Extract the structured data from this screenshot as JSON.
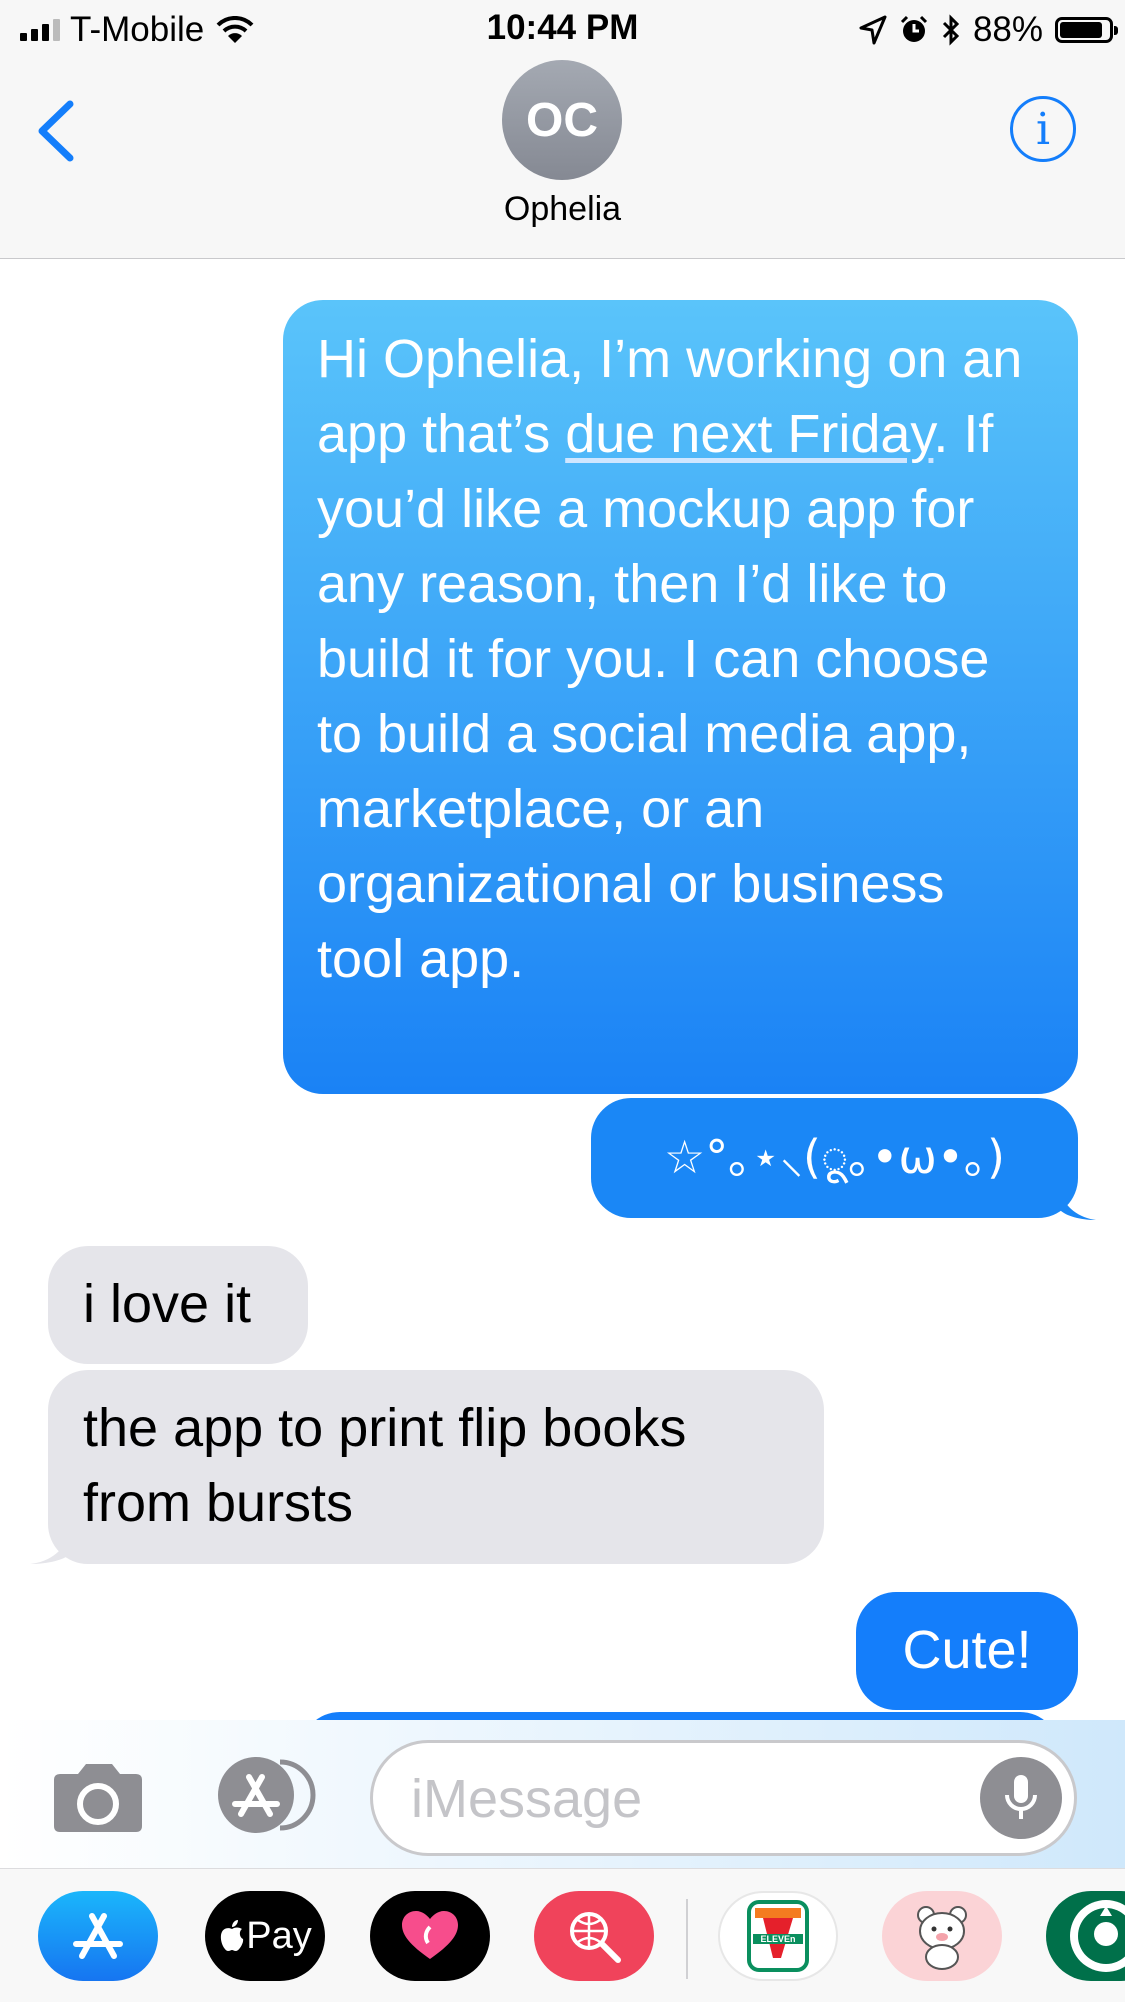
{
  "status_bar": {
    "carrier": "T-Mobile",
    "time": "10:44 PM",
    "battery": "88%",
    "battery_level": 0.88,
    "icons": [
      "signal-icon",
      "wifi-icon",
      "location-icon",
      "alarm-icon",
      "bluetooth-icon",
      "battery-icon"
    ]
  },
  "header": {
    "avatar_initials": "OC",
    "contact_name": "Ophelia",
    "icons": [
      "chevron-left-icon",
      "info-icon"
    ]
  },
  "messages": [
    {
      "direction": "outgoing",
      "part1": "Hi Ophelia, I’m working on an app that’s ",
      "link": "due next Friday",
      "part2": ". If you’d like a mockup app for any reason, then I’d like to build it for you. I can choose to build a social media app, marketplace, or an organizational or business tool app."
    },
    {
      "direction": "outgoing",
      "text": "☆°｡⋆⸜(ू｡•ω•｡)"
    },
    {
      "direction": "incoming",
      "text": "i love it"
    },
    {
      "direction": "incoming",
      "text": "the app to print flip books from bursts"
    },
    {
      "direction": "outgoing",
      "text": "Cute!"
    }
  ],
  "input_bar": {
    "placeholder": "iMessage",
    "icons": [
      "camera-icon",
      "app-store-icon",
      "microphone-icon"
    ]
  },
  "app_drawer": {
    "apps": [
      {
        "name": "App Store",
        "icon": "app-store-icon"
      },
      {
        "name": "Apple Pay",
        "label": "Pay",
        "icon": "apple-pay-icon"
      },
      {
        "name": "Digital Touch",
        "icon": "heart-icon"
      },
      {
        "name": "Search",
        "icon": "globe-search-icon"
      },
      {
        "name": "7-Eleven",
        "label": "ELEVEn",
        "icon": "seven-eleven-icon"
      },
      {
        "name": "Bear stickers",
        "icon": "bear-sticker-icon"
      },
      {
        "name": "Starbucks",
        "icon": "starbucks-icon"
      }
    ]
  },
  "colors": {
    "imessage_blue": "#147efb",
    "incoming_gray": "#e5e5ea",
    "header_bg": "#f7f7f7"
  }
}
